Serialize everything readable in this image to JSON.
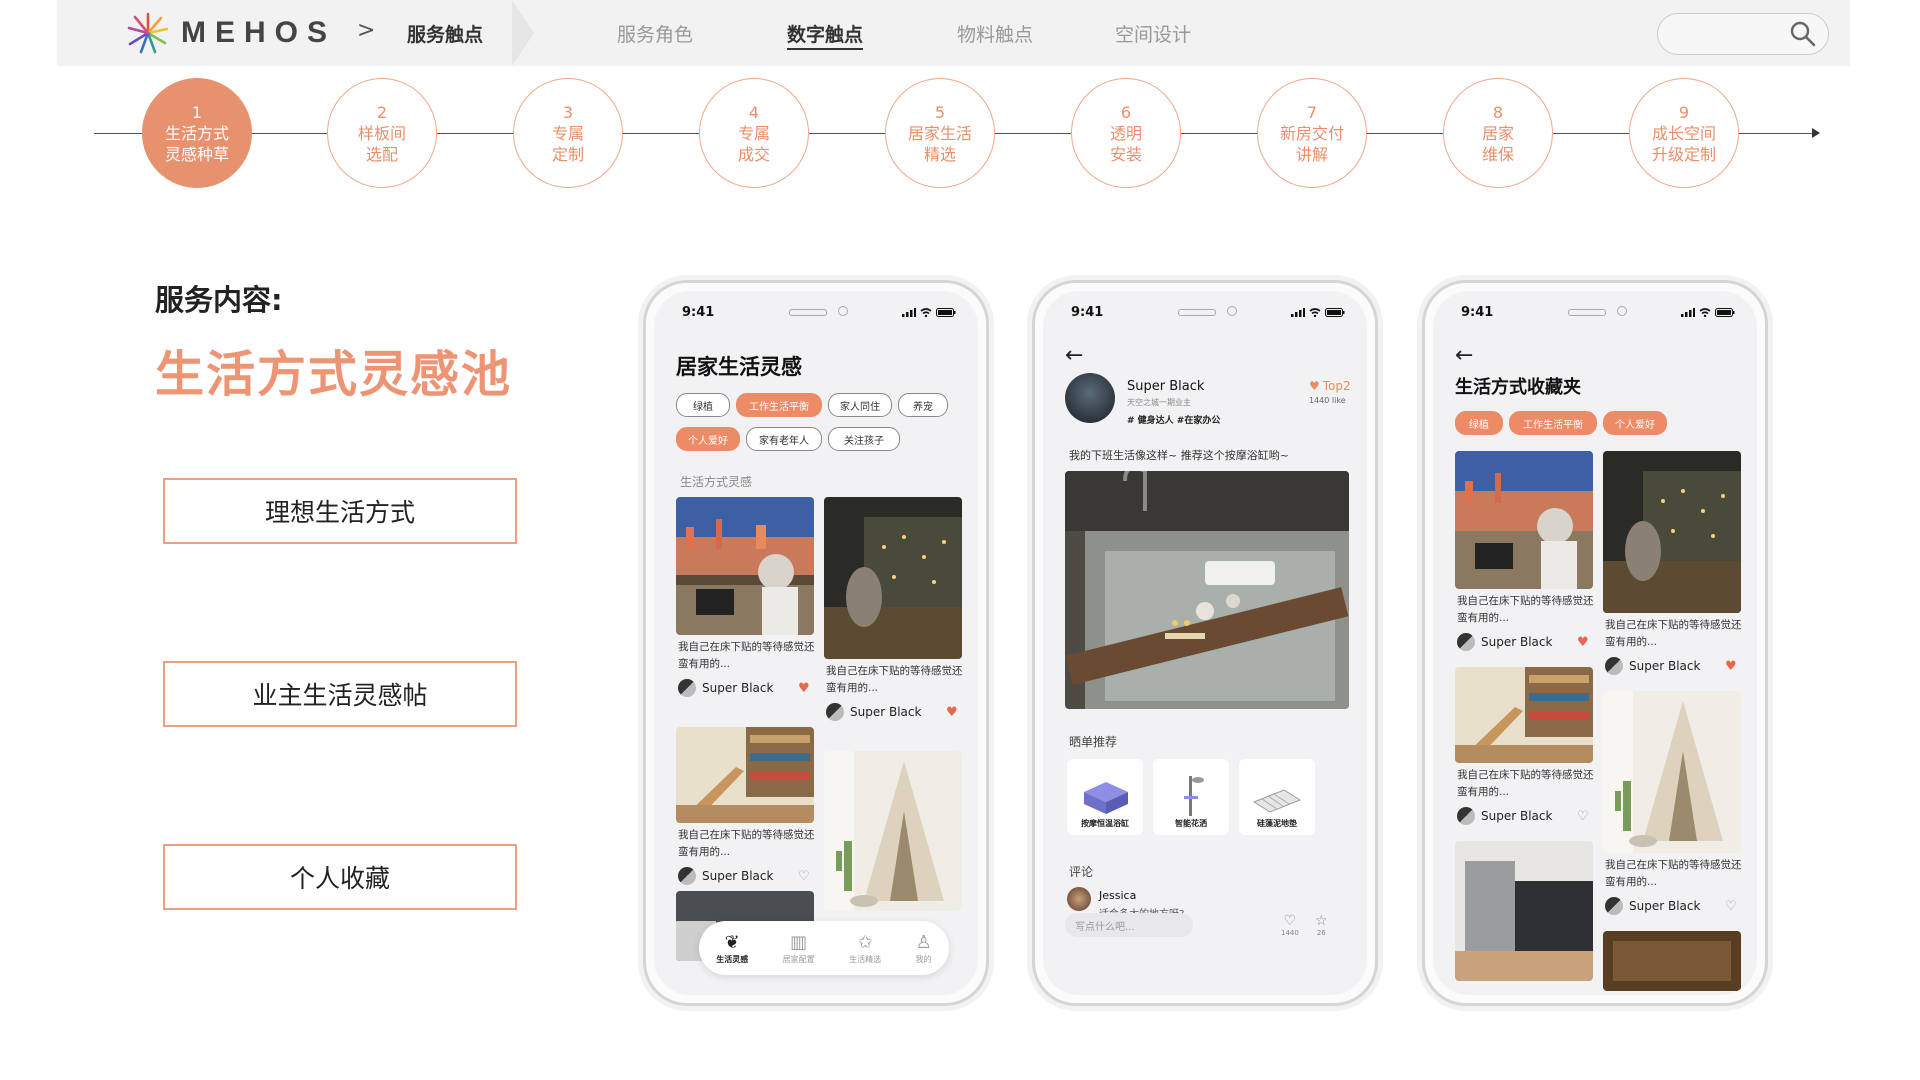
{
  "header": {
    "brand": "MEHOS",
    "separator": ">",
    "breadcrumb": "服务触点",
    "nav": [
      "服务角色",
      "数字触点",
      "物料触点",
      "空间设计"
    ],
    "active_nav": "数字触点"
  },
  "steps": [
    {
      "num": "1",
      "l1": "生活方式",
      "l2": "灵感种草"
    },
    {
      "num": "2",
      "l1": "样板间",
      "l2": "选配"
    },
    {
      "num": "3",
      "l1": "专属",
      "l2": "定制"
    },
    {
      "num": "4",
      "l1": "专属",
      "l2": "成交"
    },
    {
      "num": "5",
      "l1": "居家生活",
      "l2": "精选"
    },
    {
      "num": "6",
      "l1": "透明",
      "l2": "安装"
    },
    {
      "num": "7",
      "l1": "新房交付",
      "l2": "讲解"
    },
    {
      "num": "8",
      "l1": "居家",
      "l2": "维保"
    },
    {
      "num": "9",
      "l1": "成长空间",
      "l2": "升级定制"
    }
  ],
  "service": {
    "label": "服务内容:",
    "name": "生活方式灵感池",
    "features": [
      "理想生活方式",
      "业主生活灵感帖",
      "个人收藏"
    ]
  },
  "phone1": {
    "time": "9:41",
    "title": "居家生活灵感",
    "tags": [
      "绿植",
      "工作生活平衡",
      "家人同住",
      "养宠",
      "个人爱好",
      "家有老年人",
      "关注孩子"
    ],
    "section": "生活方式灵感",
    "card_text": "我自己在床下贴的等待感觉还蛮有用的...",
    "user": "Super Black",
    "tabs": [
      "生活灵感",
      "居家配置",
      "生活精选",
      "我的"
    ]
  },
  "phone2": {
    "time": "9:41",
    "user": "Super Black",
    "user_sub": "天空之城一期业主",
    "user_tags": "# 健身达人  #在家办公",
    "rank": "Top2",
    "likes": "1440 like",
    "caption": "我的下班生活像这样~ 推荐这个按摩浴缸哟~",
    "rec_label": "晒单推荐",
    "products": [
      "按摩恒温浴缸",
      "智能花洒",
      "硅藻泥地垫"
    ],
    "comment_label": "评论",
    "commenter": "Jessica",
    "comment_text": "适合多大的地方呀?",
    "input_placeholder": "写点什么吧...",
    "like_count": "1440",
    "star_count": "26"
  },
  "phone3": {
    "time": "9:41",
    "title": "生活方式收藏夹",
    "tags": [
      "绿植",
      "工作生活平衡",
      "个人爱好"
    ],
    "card_text": "我自己在床下贴的等待感觉还蛮有用的...",
    "user": "Super Black"
  },
  "colors": {
    "accent": "#ec8b66",
    "accent_light": "#f0a889",
    "nav_bg": "#f2f2f2"
  }
}
